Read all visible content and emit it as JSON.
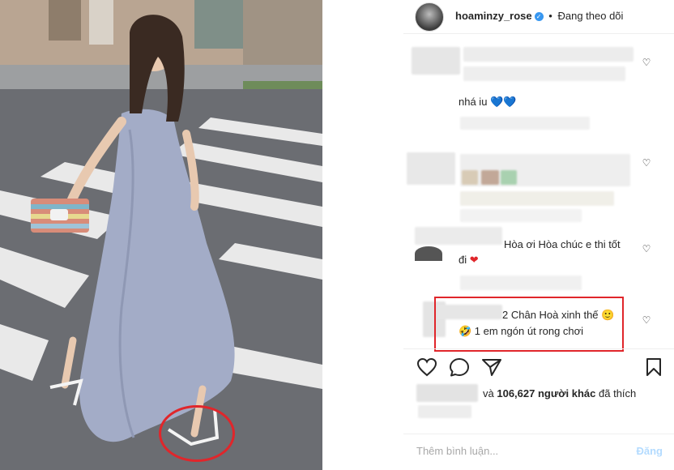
{
  "header": {
    "username": "hoaminzy_rose",
    "verified_mark": "✓",
    "separator": "•",
    "follow_status": "Đang theo dõi"
  },
  "comments": [
    {
      "text": "nhá iu 💙💙"
    },
    {
      "text": ""
    },
    {
      "text_line1": "Hòa ơi Hòa chúc e thi tốt",
      "text_line2": "đi",
      "emoji": "❤"
    },
    {
      "text_line1": "2 Chân Hoà xinh thế 🙂",
      "text_line2": "🤣 1 em ngón út rong chơi"
    }
  ],
  "icons": {
    "heart": "♡"
  },
  "likes": {
    "prefix": "và",
    "count": "106,627",
    "middle": "người khác",
    "suffix": "đã thích"
  },
  "composer": {
    "placeholder": "Thêm bình luận...",
    "post_label": "Đăng"
  },
  "colors": {
    "highlight": "#e0262b",
    "verified": "#3897f0"
  }
}
